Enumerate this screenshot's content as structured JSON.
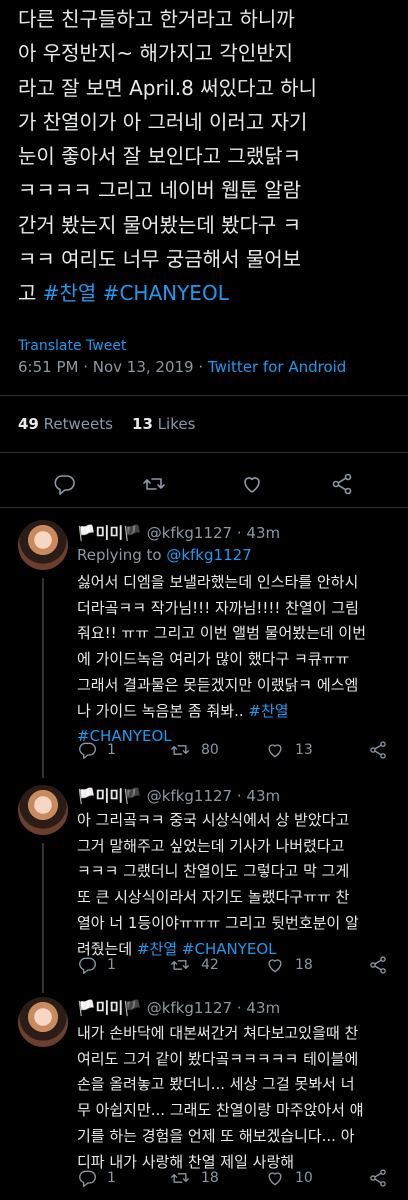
{
  "main_tweet": {
    "text": "다른 친구들하고 한거라고 하니까\n아 우정반지~ 해가지고 각인반지\n라고 잘 보면 April.8 써있다고 하니\n가 찬열이가 아 그러네 이러고 자기\n눈이 좋아서 잘 보인다고 그랬닭ㅋ\nㅋㅋㅋㅋ 그리고 네이버 웹툰 알람\n간거 봤는지 물어봤는데 봤다구 ㅋ\nㅋㅋ 여리도 너무 궁금해서 물어보\n고 ",
    "hashtags": [
      "#찬열",
      "#CHANYEOL"
    ],
    "translate_label": "Translate Tweet",
    "time": "6:51 PM · Nov 13, 2019 · ",
    "source": "Twitter for Android",
    "retweets_count": "49",
    "retweets_label": "Retweets",
    "likes_count": "13",
    "likes_label": "Likes"
  },
  "replies": [
    {
      "name": "🏳️미미🏴",
      "handle": "@kfkg1127 · 43m",
      "replying_to_label": "Replying to ",
      "replying_to_handle": "@kfkg1127",
      "text": "싫어서 디엠을 보낼라했는데 인스타를 안하시\n더라곸ㅋㅋ 작가님!!! 자까님!!!! 찬열이 그림\n줘요!! ㅠㅠ 그리고 이번 앨범 물어봤는데 이번\n에 가이드녹음 여리가 많이 했다구 ㅋ큐ㅠㅠ\n그래서 결과물은 못듣겠지만 이랬닭ㅋ 에스엠\n나 가이드 녹음본 좀 줘봐.. ",
      "hashtags": [
        "#찬열",
        "#CHANYEOL"
      ],
      "reply_count": "1",
      "retweet_count": "80",
      "like_count": "13"
    },
    {
      "name": "🏳️미미🏴",
      "handle": "@kfkg1127 · 43m",
      "text": "아 그리곸ㅋㅋ 중국 시상식에서 상 받았다고\n그거 말해주고 싶었는데 기사가 나버렸다고\nㅋㅋㅋ 그랬더니 찬열이도 그렇다고 막 그게\n또 큰 시상식이라서 자기도 놀랬다구ㅠㅠ 찬\n열아 너 1등이야ㅠㅠㅠ 그리고 뒷번호분이 알\n려줬는데 ",
      "hashtags": [
        "#찬열",
        "#CHANYEOL"
      ],
      "reply_count": "1",
      "retweet_count": "42",
      "like_count": "18"
    },
    {
      "name": "🏳️미미🏴",
      "handle": "@kfkg1127 · 43m",
      "text": "내가 손바닥에 대본써간거 쳐다보고있을때 찬\n여리도 그거 같이 봤다곸ㅋㅋㅋㅋㅋ 테이블에\n손을 올려놓고 봤더니... 세상 그걸 못봐서 너\n무 아쉽지만... 그래도 찬열이랑 마주앉아서 얘\n기를 하는 경험을 언제 또 해보겠습니다... 아\n디파 내가 사랑해 찬열 제일 사랑해",
      "reply_count": "1",
      "retweet_count": "18",
      "like_count": "10"
    }
  ],
  "colors": {
    "background": "#000000",
    "text": "#e7e9ea",
    "muted": "#8b98a5",
    "accent": "#1d9bf0",
    "divider": "#2f3336"
  },
  "icons": [
    "reply-icon",
    "retweet-icon",
    "like-icon",
    "share-icon"
  ]
}
